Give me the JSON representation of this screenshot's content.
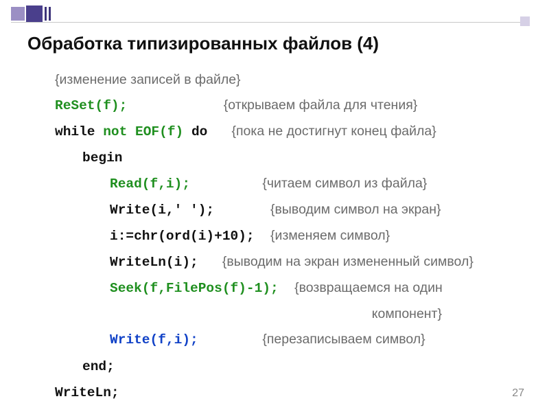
{
  "title": "Обработка типизированных файлов (4)",
  "page_number": "27",
  "lines": {
    "c1": "{изменение записей в файле}",
    "code2a": "ReSet(f);",
    "c2": "{открываем файла для чтения}",
    "code3a": "while ",
    "code3b": "not EOF(f)",
    "code3c": " do",
    "c3": "{пока не достигнут конец файла}",
    "code4": "begin",
    "code5": "Read(f,i);",
    "c5": "{читаем символ из файла}",
    "code6": "Write(i,' ');",
    "c6": "{выводим символ на экран}",
    "code7": "i:=chr(ord(i)+10);",
    "c7": "{изменяем символ}",
    "code8": "WriteLn(i);",
    "c8": "{выводим на экран измененный символ}",
    "code9": "Seek(f,FilePos(f)-1);",
    "c9a": "{возвращаемся на один",
    "c9b": "компонент}",
    "code10": "Write(f,i);",
    "c10": "{перезаписываем символ}",
    "code11": "end;",
    "code12": "WriteLn;"
  }
}
